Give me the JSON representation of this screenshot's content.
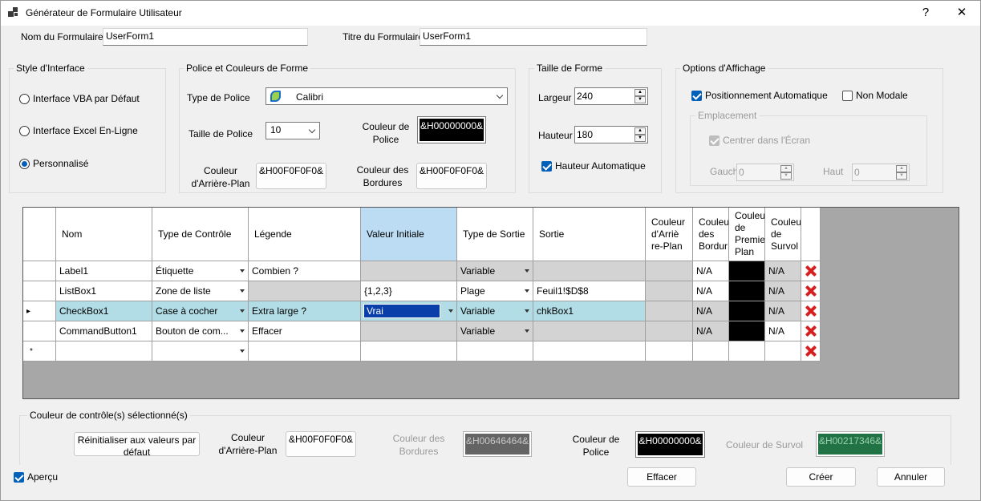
{
  "window": {
    "title": "Générateur de Formulaire Utilisateur",
    "help": "?",
    "close": "✕"
  },
  "form": {
    "name_label": "Nom du Formulaire",
    "name_value": "UserForm1",
    "title_label": "Titre du Formulaire",
    "title_value": "UserForm1"
  },
  "style": {
    "title": "Style d'Interface",
    "options": [
      "Interface VBA par Défaut",
      "Interface Excel En-Ligne",
      "Personnalisé"
    ],
    "selected": "Personnalisé"
  },
  "font_colors": {
    "title": "Police et Couleurs de Forme",
    "font_type_label": "Type de Police",
    "font_type_value": "Calibri",
    "font_size_label": "Taille de Police",
    "font_size_value": "10",
    "font_color_label": "Couleur de Police",
    "font_color_value": "&H00000000&",
    "back_color_label": "Couleur d'Arrière-Plan",
    "back_color_value": "&H00F0F0F0&",
    "border_color_label": "Couleur des Bordures",
    "border_color_value": "&H00F0F0F0&"
  },
  "size": {
    "title": "Taille de Forme",
    "width_label": "Largeur",
    "width_value": "240",
    "height_label": "Hauteur",
    "height_value": "180",
    "auto_height_label": "Hauteur Automatique"
  },
  "display": {
    "title": "Options d'Affichage",
    "auto_position_label": "Positionnement Automatique",
    "modeless_label": "Non Modale",
    "placement_title": "Emplacement",
    "center_label": "Centrer dans l'Écran",
    "left_label": "Gauch",
    "left_value": "0",
    "top_label": "Haut",
    "top_value": "0"
  },
  "grid": {
    "headers": [
      "Nom",
      "Type de Contrôle",
      "Légende",
      "Valeur Initiale",
      "Type de Sortie",
      "Sortie",
      "Couleur d'Arriè re-Plan",
      "Couleur des Bordur",
      "Couleur de Premie Plan",
      "Couleur de Survol"
    ],
    "rows": [
      {
        "name": "Label1",
        "type": "Étiquette",
        "caption": "Combien ?",
        "initial": "",
        "out_type": "Variable",
        "output": "",
        "bord": "N/A",
        "survol": "N/A"
      },
      {
        "name": "ListBox1",
        "type": "Zone de liste",
        "caption": "",
        "initial": "{1,2,3}",
        "out_type": "Plage",
        "output": "Feuil1!$D$8",
        "bord": "N/A",
        "survol": "N/A"
      },
      {
        "name": "CheckBox1",
        "type": "Case à cocher",
        "caption": "Extra large ?",
        "initial": "Vrai",
        "out_type": "Variable",
        "output": "chkBox1",
        "bord": "N/A",
        "survol": "N/A"
      },
      {
        "name": "CommandButton1",
        "type": "Bouton de com...",
        "caption": "Effacer",
        "initial": "",
        "out_type": "Variable",
        "output": "",
        "bord": "N/A",
        "survol": "N/A"
      }
    ],
    "new_row_marker": "*",
    "current_row_marker": "▸"
  },
  "selected": {
    "title": "Couleur de contrôle(s) sélectionné(s)",
    "reset_label": "Réinitialiser aux valeurs par défaut",
    "back_label": "Couleur d'Arrière-Plan",
    "back_value": "&H00F0F0F0&",
    "border_label": "Couleur des Bordures",
    "border_value": "&H00646464&",
    "font_label": "Couleur de Police",
    "font_value": "&H00000000&",
    "hover_label": "Couleur de Survol",
    "hover_value": "&H00217346&"
  },
  "footer": {
    "preview_label": "Aperçu",
    "clear": "Effacer",
    "create": "Créer",
    "cancel": "Annuler"
  },
  "colors": {
    "accent": "#005fb8",
    "border_swatch": "#646464",
    "hover_swatch": "#217346",
    "selected_row": "#b2dde6"
  }
}
